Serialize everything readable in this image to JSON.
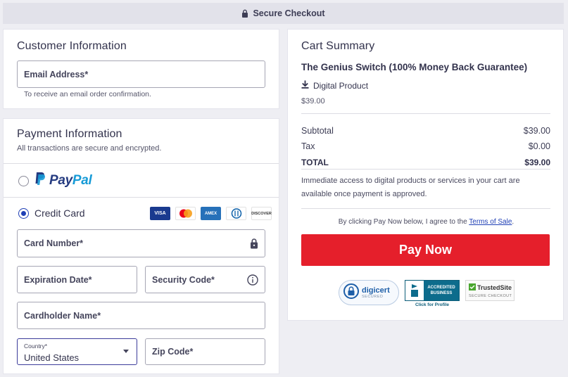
{
  "header": {
    "title": "Secure Checkout"
  },
  "customer": {
    "title": "Customer Information",
    "email_label": "Email Address*",
    "email_hint": "To receive an email order confirmation."
  },
  "payment": {
    "title": "Payment Information",
    "subtitle": "All transactions are secure and encrypted.",
    "paypal_pay": "Pay",
    "paypal_pal": "Pal",
    "credit_card_label": "Credit Card",
    "card_brands": [
      "VISA",
      "Mastercard",
      "AMEX",
      "Diners",
      "DISCOVER"
    ],
    "card_number_label": "Card Number*",
    "expiration_label": "Expiration Date*",
    "security_label": "Security Code*",
    "cardholder_label": "Cardholder Name*",
    "country_label": "Country*",
    "country_value": "United States",
    "zip_label": "Zip Code*"
  },
  "cart": {
    "title": "Cart Summary",
    "product_name": "The Genius Switch (100% Money Back Guarantee)",
    "product_type": "Digital Product",
    "product_price": "$39.00",
    "subtotal_label": "Subtotal",
    "subtotal_value": "$39.00",
    "tax_label": "Tax",
    "tax_value": "$0.00",
    "total_label": "TOTAL",
    "total_value": "$39.00",
    "note": "Immediate access to digital products or services in your cart are available once payment is approved.",
    "agree_prefix": "By clicking Pay Now below, I agree to the ",
    "agree_link": "Terms of Sale",
    "agree_suffix": ".",
    "pay_button": "Pay Now"
  },
  "badges": {
    "digicert": "digicert",
    "digicert_sub": "SECURED",
    "bbb_line1": "ACCREDITED",
    "bbb_line2": "BUSINESS",
    "bbb_caption": "Click for Profile",
    "trusted": "TrustedSite",
    "trusted_sub": "SECURE CHECKOUT"
  },
  "colors": {
    "accent": "#1f3fb5",
    "pay_button": "#e51f2b",
    "paypal_dark": "#253b80",
    "paypal_light": "#179bd7"
  }
}
